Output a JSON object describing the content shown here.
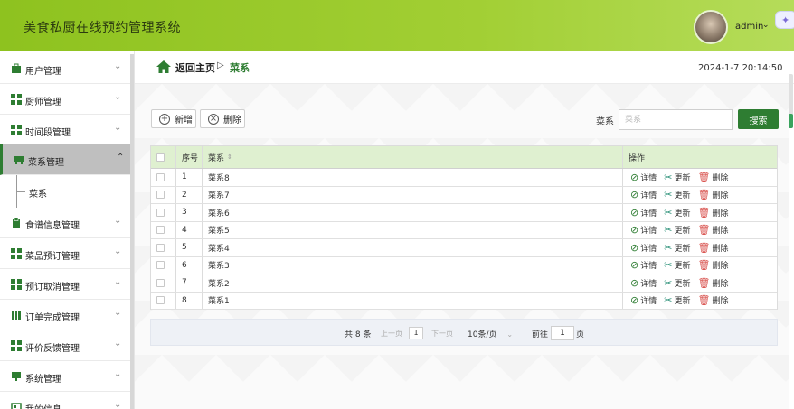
{
  "header": {
    "app_title": "美食私厨在线预约管理系统",
    "user_name": "admin",
    "caret": "⌄"
  },
  "sidebar": {
    "items": [
      {
        "label": "用户管理",
        "icon": "briefcase-icon"
      },
      {
        "label": "厨师管理",
        "icon": "grid-icon"
      },
      {
        "label": "时间段管理",
        "icon": "grid-icon"
      },
      {
        "label": "菜系管理",
        "icon": "desk-icon",
        "active": true
      },
      {
        "label": "食谱信息管理",
        "icon": "clipboard-icon"
      },
      {
        "label": "菜品预订管理",
        "icon": "grid-icon"
      },
      {
        "label": "预订取消管理",
        "icon": "grid-icon"
      },
      {
        "label": "订单完成管理",
        "icon": "columns-icon"
      },
      {
        "label": "评价反馈管理",
        "icon": "grid-icon"
      },
      {
        "label": "系统管理",
        "icon": "monitor-icon"
      },
      {
        "label": "我的信息",
        "icon": "card-icon"
      }
    ],
    "sub_item": "菜系"
  },
  "breadcrumb": {
    "home": "返回主页",
    "arrow": "▷",
    "current": "菜系"
  },
  "datetime": "2024-1-7 20:14:50",
  "toolbar": {
    "add_label": "新增",
    "delete_label": "删除",
    "search_label": "菜系",
    "search_placeholder": "菜系",
    "search_button": "搜索"
  },
  "table": {
    "headers": {
      "index": "序号",
      "cuisine": "菜系",
      "actions": "操作"
    },
    "rows": [
      {
        "index": "1",
        "cuisine": "菜系8"
      },
      {
        "index": "2",
        "cuisine": "菜系7"
      },
      {
        "index": "3",
        "cuisine": "菜系6"
      },
      {
        "index": "4",
        "cuisine": "菜系5"
      },
      {
        "index": "5",
        "cuisine": "菜系4"
      },
      {
        "index": "6",
        "cuisine": "菜系3"
      },
      {
        "index": "7",
        "cuisine": "菜系2"
      },
      {
        "index": "8",
        "cuisine": "菜系1"
      }
    ],
    "actions": {
      "detail": "详情",
      "edit": "更新",
      "delete": "删除"
    }
  },
  "pagination": {
    "total": "共 8 条",
    "prev": "上一页",
    "current_page": "1",
    "next": "下一页",
    "page_size": "10条/页",
    "goto_label": "前往",
    "goto_value": "1",
    "goto_suffix": "页"
  },
  "colors": {
    "header_green": "#8ec21f",
    "primary_green": "#2e7d32",
    "table_header_bg": "#dff0d0",
    "delete_red": "#d9534f"
  }
}
